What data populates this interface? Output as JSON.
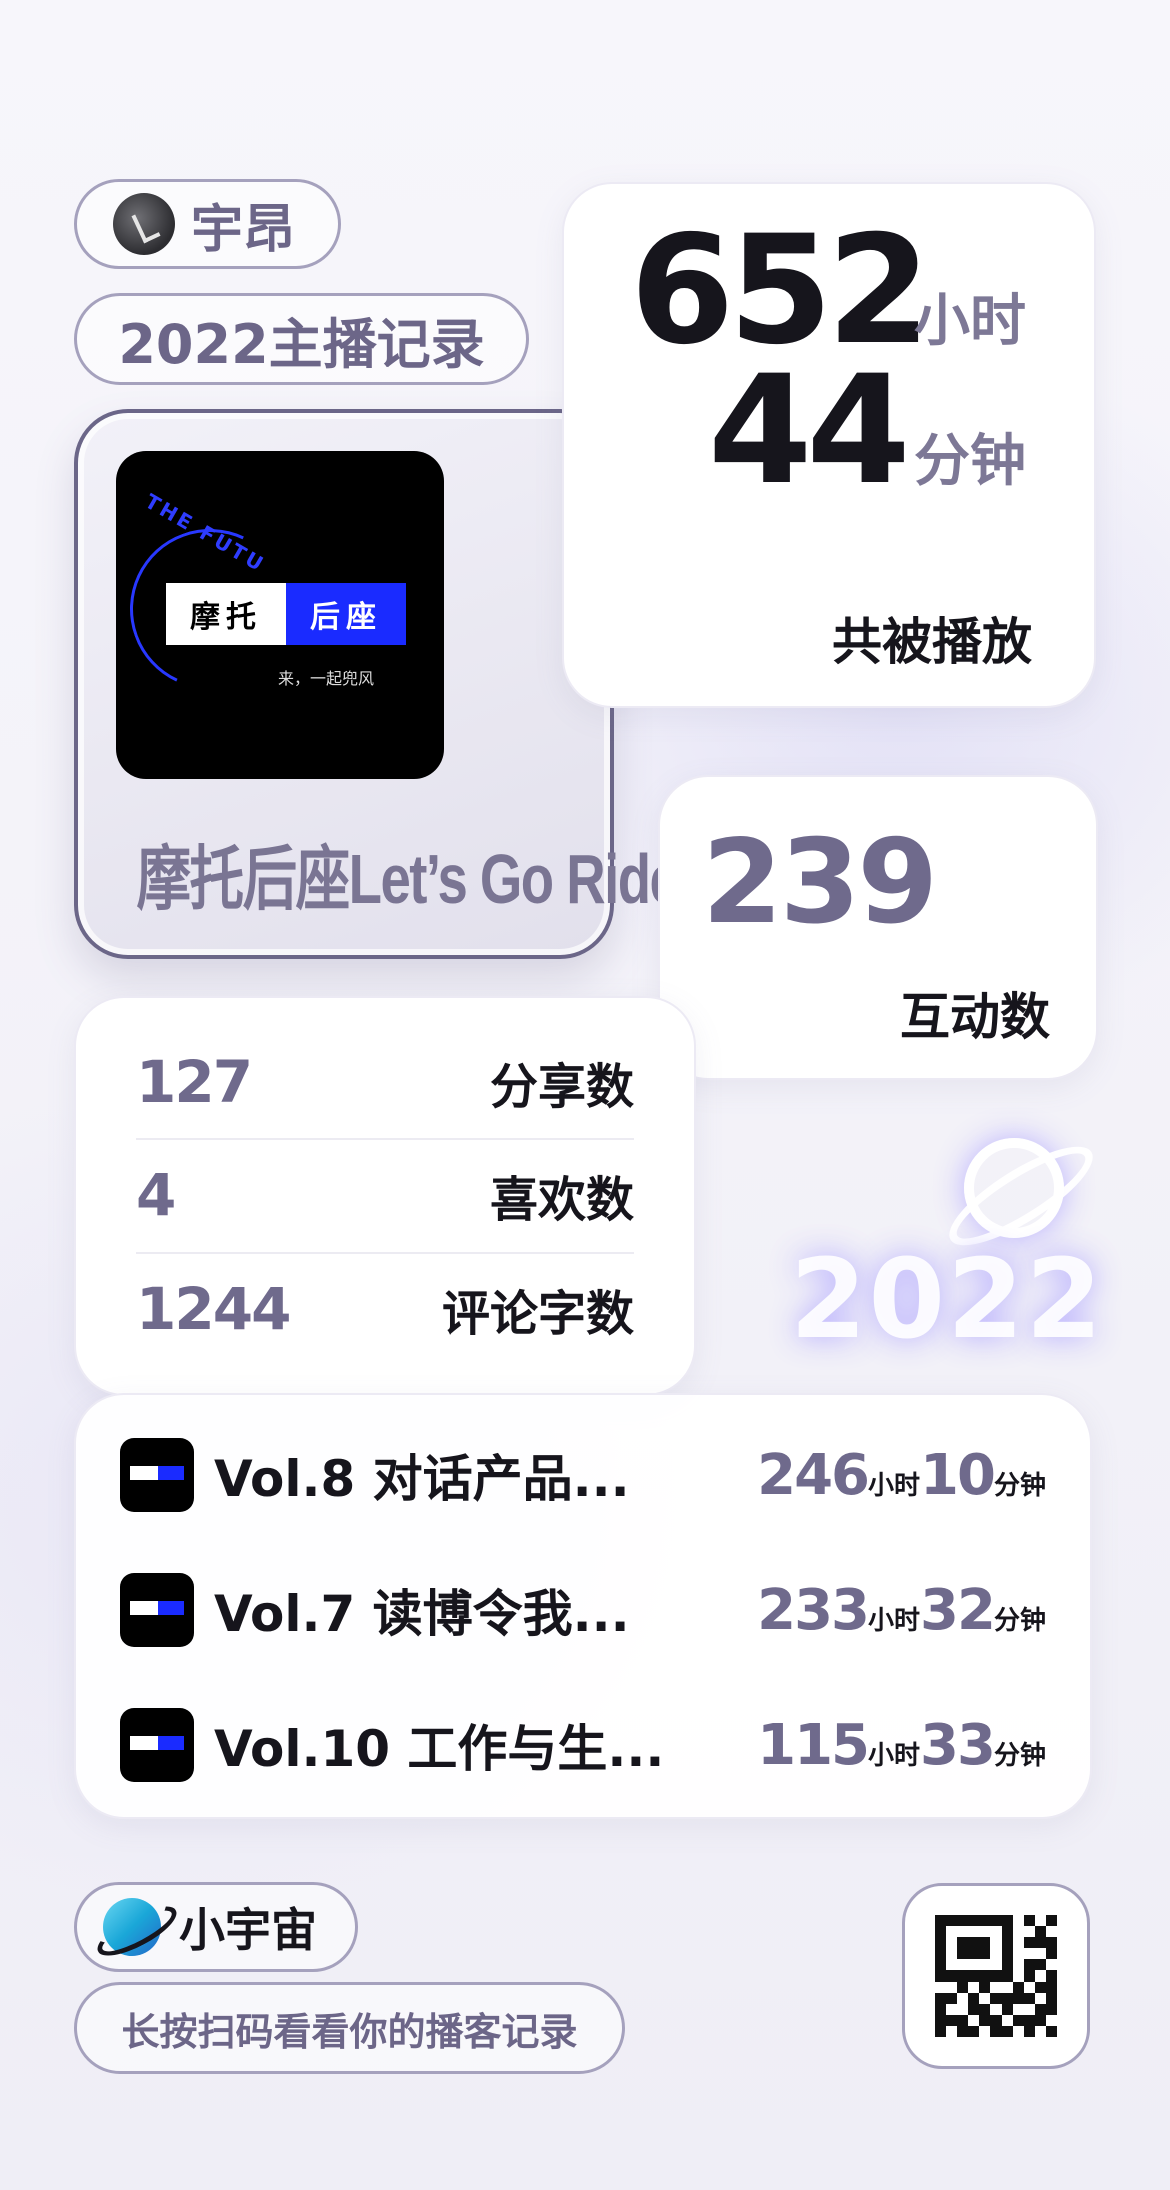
{
  "user": {
    "name": "宇昂"
  },
  "report": {
    "year_label": "2022主播记录"
  },
  "podcast": {
    "title": "摩托后座Let’s Go Ride!",
    "cover": {
      "left": "摩托",
      "right": "后座",
      "sub": "来，一起兜风",
      "arc_text": "THE FUTU"
    }
  },
  "play_time": {
    "hours": "652",
    "hours_unit": "小时",
    "minutes": "44",
    "minutes_unit": "分钟",
    "label": "共被播放"
  },
  "interactions": {
    "value": "239",
    "label": "互动数"
  },
  "stats": [
    {
      "value": "127",
      "label": "分享数"
    },
    {
      "value": "4",
      "label": "喜欢数"
    },
    {
      "value": "1244",
      "label": "评论字数"
    }
  ],
  "decor": {
    "year": "2022"
  },
  "episodes": [
    {
      "title": "Vol.8 对话产品...",
      "hours": "246",
      "hours_unit": "小时",
      "minutes": "10",
      "minutes_unit": "分钟"
    },
    {
      "title": "Vol.7 读博令我...",
      "hours": "233",
      "hours_unit": "小时",
      "minutes": "32",
      "minutes_unit": "分钟"
    },
    {
      "title": "Vol.10 工作与生...",
      "hours": "115",
      "hours_unit": "小时",
      "minutes": "33",
      "minutes_unit": "分钟"
    }
  ],
  "footer": {
    "brand": "小宇宙",
    "cta": "长按扫码看看你的播客记录"
  },
  "colors": {
    "accent": "#6f6a8c",
    "cover_blue": "#1a2bff",
    "text": "#16151c"
  }
}
